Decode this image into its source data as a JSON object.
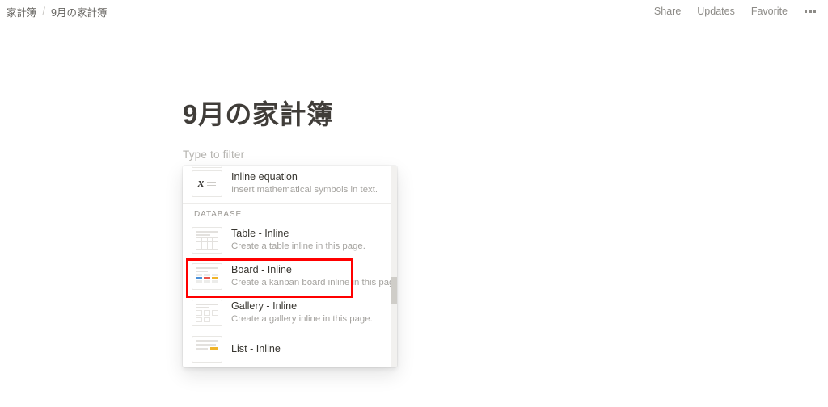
{
  "topbar": {
    "breadcrumb": {
      "parent": "家計簿",
      "separator": "/",
      "current": "9月の家計簿"
    },
    "actions": [
      {
        "label": "Share"
      },
      {
        "label": "Updates"
      },
      {
        "label": "Favorite"
      }
    ],
    "more_icon": "more-horizontal-icon"
  },
  "page": {
    "title": "9月の家計簿",
    "filter_placeholder": "Type to filter"
  },
  "menu": {
    "sections": [
      {
        "header": null,
        "items": [
          {
            "title": "Inline equation",
            "description": "Insert mathematical symbols in text.",
            "icon": "inline-equation-icon",
            "highlighted": false
          }
        ]
      },
      {
        "header": "DATABASE",
        "items": [
          {
            "title": "Table - Inline",
            "description": "Create a table inline in this page.",
            "icon": "table-inline-icon",
            "highlighted": true
          },
          {
            "title": "Board - Inline",
            "description": "Create a kanban board inline in this page.",
            "icon": "board-inline-icon",
            "highlighted": false
          },
          {
            "title": "Gallery - Inline",
            "description": "Create a gallery inline in this page.",
            "icon": "gallery-inline-icon",
            "highlighted": false
          },
          {
            "title": "List - Inline",
            "description": "",
            "icon": "list-inline-icon",
            "highlighted": false
          }
        ]
      }
    ]
  },
  "colors": {
    "highlight": "#ff0000",
    "text_primary": "#37352f",
    "text_secondary": "#a5a39f",
    "background": "#ffffff"
  }
}
